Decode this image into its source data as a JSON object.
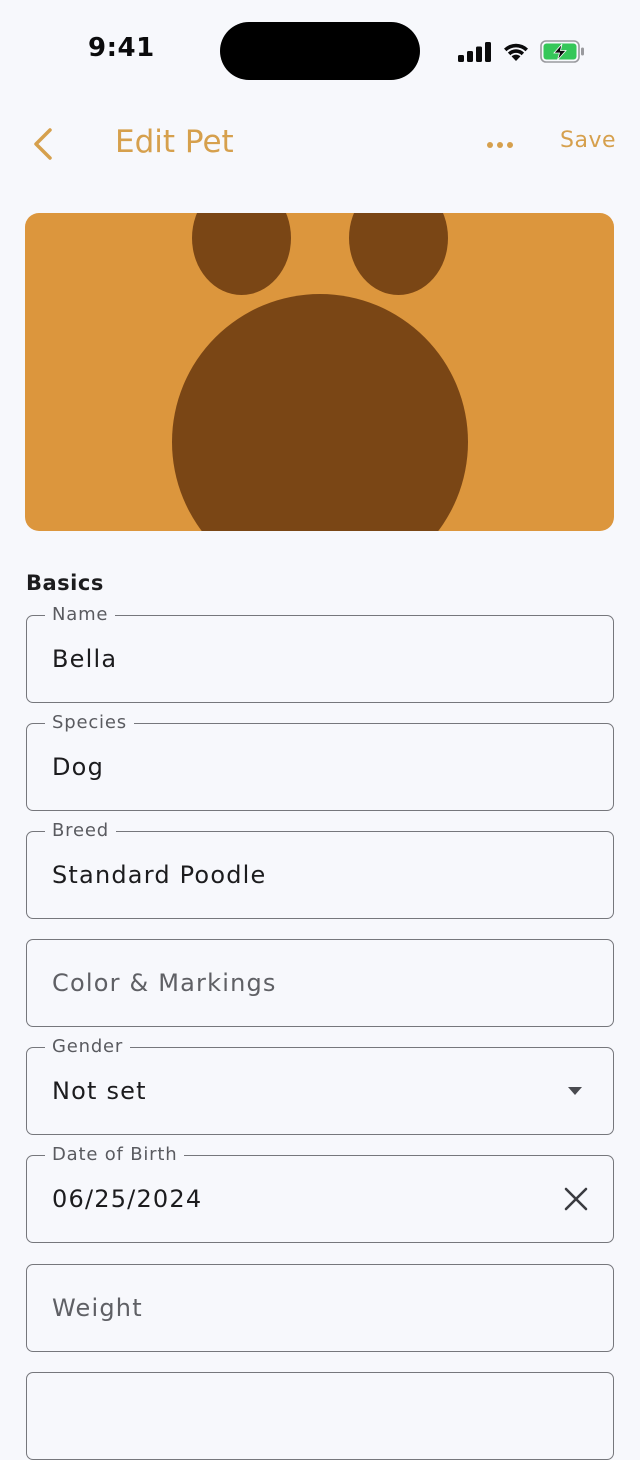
{
  "status_bar": {
    "time": "9:41"
  },
  "nav": {
    "title": "Edit Pet",
    "save_label": "Save",
    "back_icon": "chevron-left-icon",
    "more_icon": "ellipsis-icon"
  },
  "colors": {
    "accent": "#d6a04d",
    "photo_bg": "#dc963d",
    "paw": "#7a4615",
    "background": "#f7f8fc"
  },
  "section": {
    "title": "Basics"
  },
  "fields": {
    "name": {
      "label": "Name",
      "value": "Bella"
    },
    "species": {
      "label": "Species",
      "value": "Dog"
    },
    "breed": {
      "label": "Breed",
      "value": "Standard Poodle"
    },
    "color": {
      "placeholder": "Color & Markings"
    },
    "gender": {
      "label": "Gender",
      "value": "Not set"
    },
    "dob": {
      "label": "Date of Birth",
      "value": "06/25/2024"
    },
    "weight": {
      "placeholder": "Weight"
    }
  }
}
